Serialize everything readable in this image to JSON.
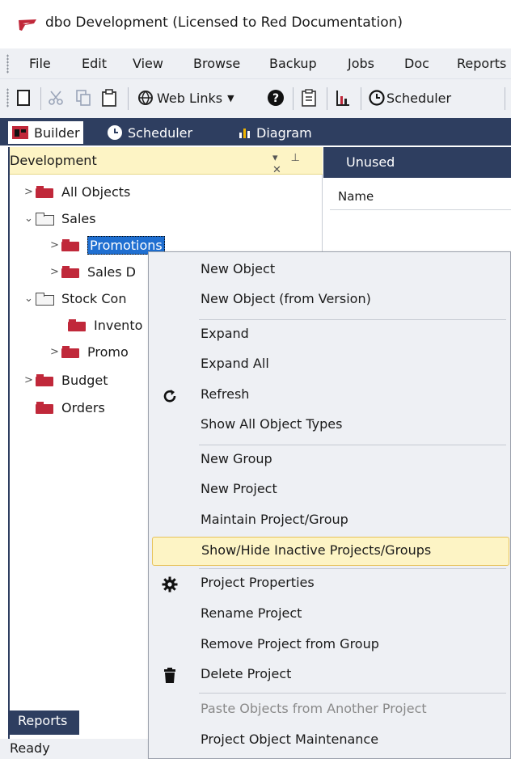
{
  "window": {
    "title": "dbo  Development  (Licensed to Red Documentation)"
  },
  "menubar": {
    "items": [
      "File",
      "Edit",
      "View",
      "Browse",
      "Backup",
      "Jobs",
      "Doc",
      "Reports"
    ]
  },
  "toolbar": {
    "web_links_label": "Web Links",
    "scheduler_label": "Scheduler"
  },
  "dock_tabs": {
    "builder": "Builder",
    "scheduler": "Scheduler",
    "diagram": "Diagram"
  },
  "left_panel": {
    "title": "Development",
    "buttons": "▾ ⊥ ✕",
    "tree": [
      {
        "label": "All Objects"
      },
      {
        "label": "Sales"
      },
      {
        "label": "Promotions"
      },
      {
        "label": "Sales D"
      },
      {
        "label": "Stock Con"
      },
      {
        "label": "Invento"
      },
      {
        "label": "Promo"
      },
      {
        "label": "Budget"
      },
      {
        "label": "Orders"
      }
    ]
  },
  "right_panel": {
    "header": "Unused",
    "column_header": "Name"
  },
  "bottom": {
    "reports_tab": "Reports",
    "status": "Ready"
  },
  "context_menu": {
    "items": [
      {
        "label": "New Object"
      },
      {
        "label": "New Object (from Version)"
      },
      {
        "label": "Expand"
      },
      {
        "label": "Expand All"
      },
      {
        "label": "Refresh",
        "icon": "refresh-icon"
      },
      {
        "label": "Show All Object Types"
      },
      {
        "label": "New Group"
      },
      {
        "label": "New Project"
      },
      {
        "label": "Maintain Project/Group"
      },
      {
        "label": "Show/Hide Inactive Projects/Groups"
      },
      {
        "label": "Project Properties",
        "icon": "gear-icon"
      },
      {
        "label": "Rename Project"
      },
      {
        "label": "Remove Project from Group"
      },
      {
        "label": "Delete Project",
        "icon": "trash-icon"
      },
      {
        "label": "Paste Objects from Another Project"
      },
      {
        "label": "Project Object Maintenance"
      }
    ]
  },
  "colors": {
    "navy": "#2e3e60",
    "highlight": "#fdf4c5",
    "selection": "#1f6fd1",
    "brand_red": "#c0283a"
  }
}
